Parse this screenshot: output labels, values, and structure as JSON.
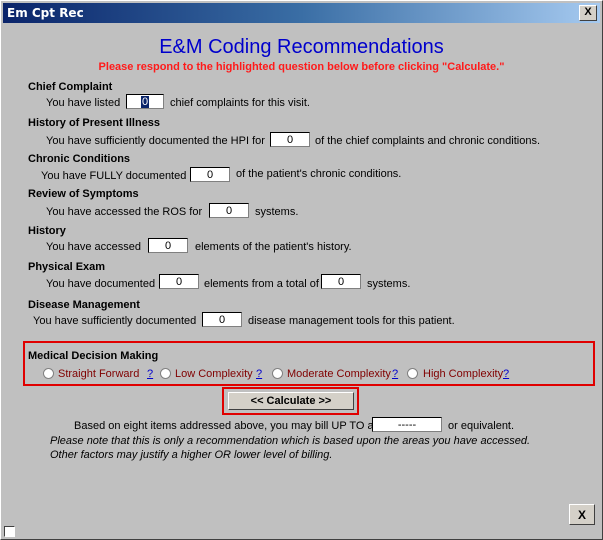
{
  "window": {
    "title": "Em Cpt Rec",
    "close_glyph": "X"
  },
  "header": {
    "title": "E&M Coding Recommendations",
    "warning": "Please respond to the highlighted question below before clicking \"Calculate.\"",
    "warning_color": "#ff1a1a",
    "title_color": "#0000cc"
  },
  "sections": {
    "chief_complaint": {
      "label": "Chief Complaint",
      "pre": "You have listed",
      "value": "0",
      "post": "chief complaints for this visit."
    },
    "hpi": {
      "label": "History of Present Illness",
      "pre": "You have sufficiently documented the HPI for",
      "value": "0",
      "post": "of the chief complaints and chronic conditions."
    },
    "chronic": {
      "label": "Chronic Conditions",
      "pre": "You have FULLY documented",
      "value": "0",
      "post": "of the patient's chronic conditions."
    },
    "ros": {
      "label": "Review of Symptoms",
      "pre": "You have accessed the ROS for",
      "value": "0",
      "post": "systems."
    },
    "history": {
      "label": "History",
      "pre": "You have accessed",
      "value": "0",
      "post": "elements of the patient's history."
    },
    "exam": {
      "label": "Physical Exam",
      "pre": "You have documented",
      "value1": "0",
      "mid": "elements from a total of",
      "value2": "0",
      "post": "systems."
    },
    "disease": {
      "label": "Disease Management",
      "pre": "You have sufficiently documented",
      "value": "0",
      "post": "disease management tools for this patient."
    }
  },
  "mdm": {
    "label": "Medical Decision Making",
    "options": [
      {
        "label": "Straight Forward",
        "help": "?"
      },
      {
        "label": "Low Complexity",
        "help": "?"
      },
      {
        "label": "Moderate Complexity",
        "help": "?"
      },
      {
        "label": "High Complexity",
        "help": "?"
      }
    ],
    "highlight_color": "#e00000"
  },
  "calculate_label": "<<  Calculate >>",
  "result": {
    "pre": "Based on eight items addressed above, you may bill UP TO a",
    "value": "-----",
    "post": "or equivalent.",
    "note1": "Please note that this is only a recommendation which is based upon the areas you have accessed.",
    "note2": "Other factors may justify a higher OR lower level of billing."
  },
  "footer": {
    "close_label": "X"
  }
}
